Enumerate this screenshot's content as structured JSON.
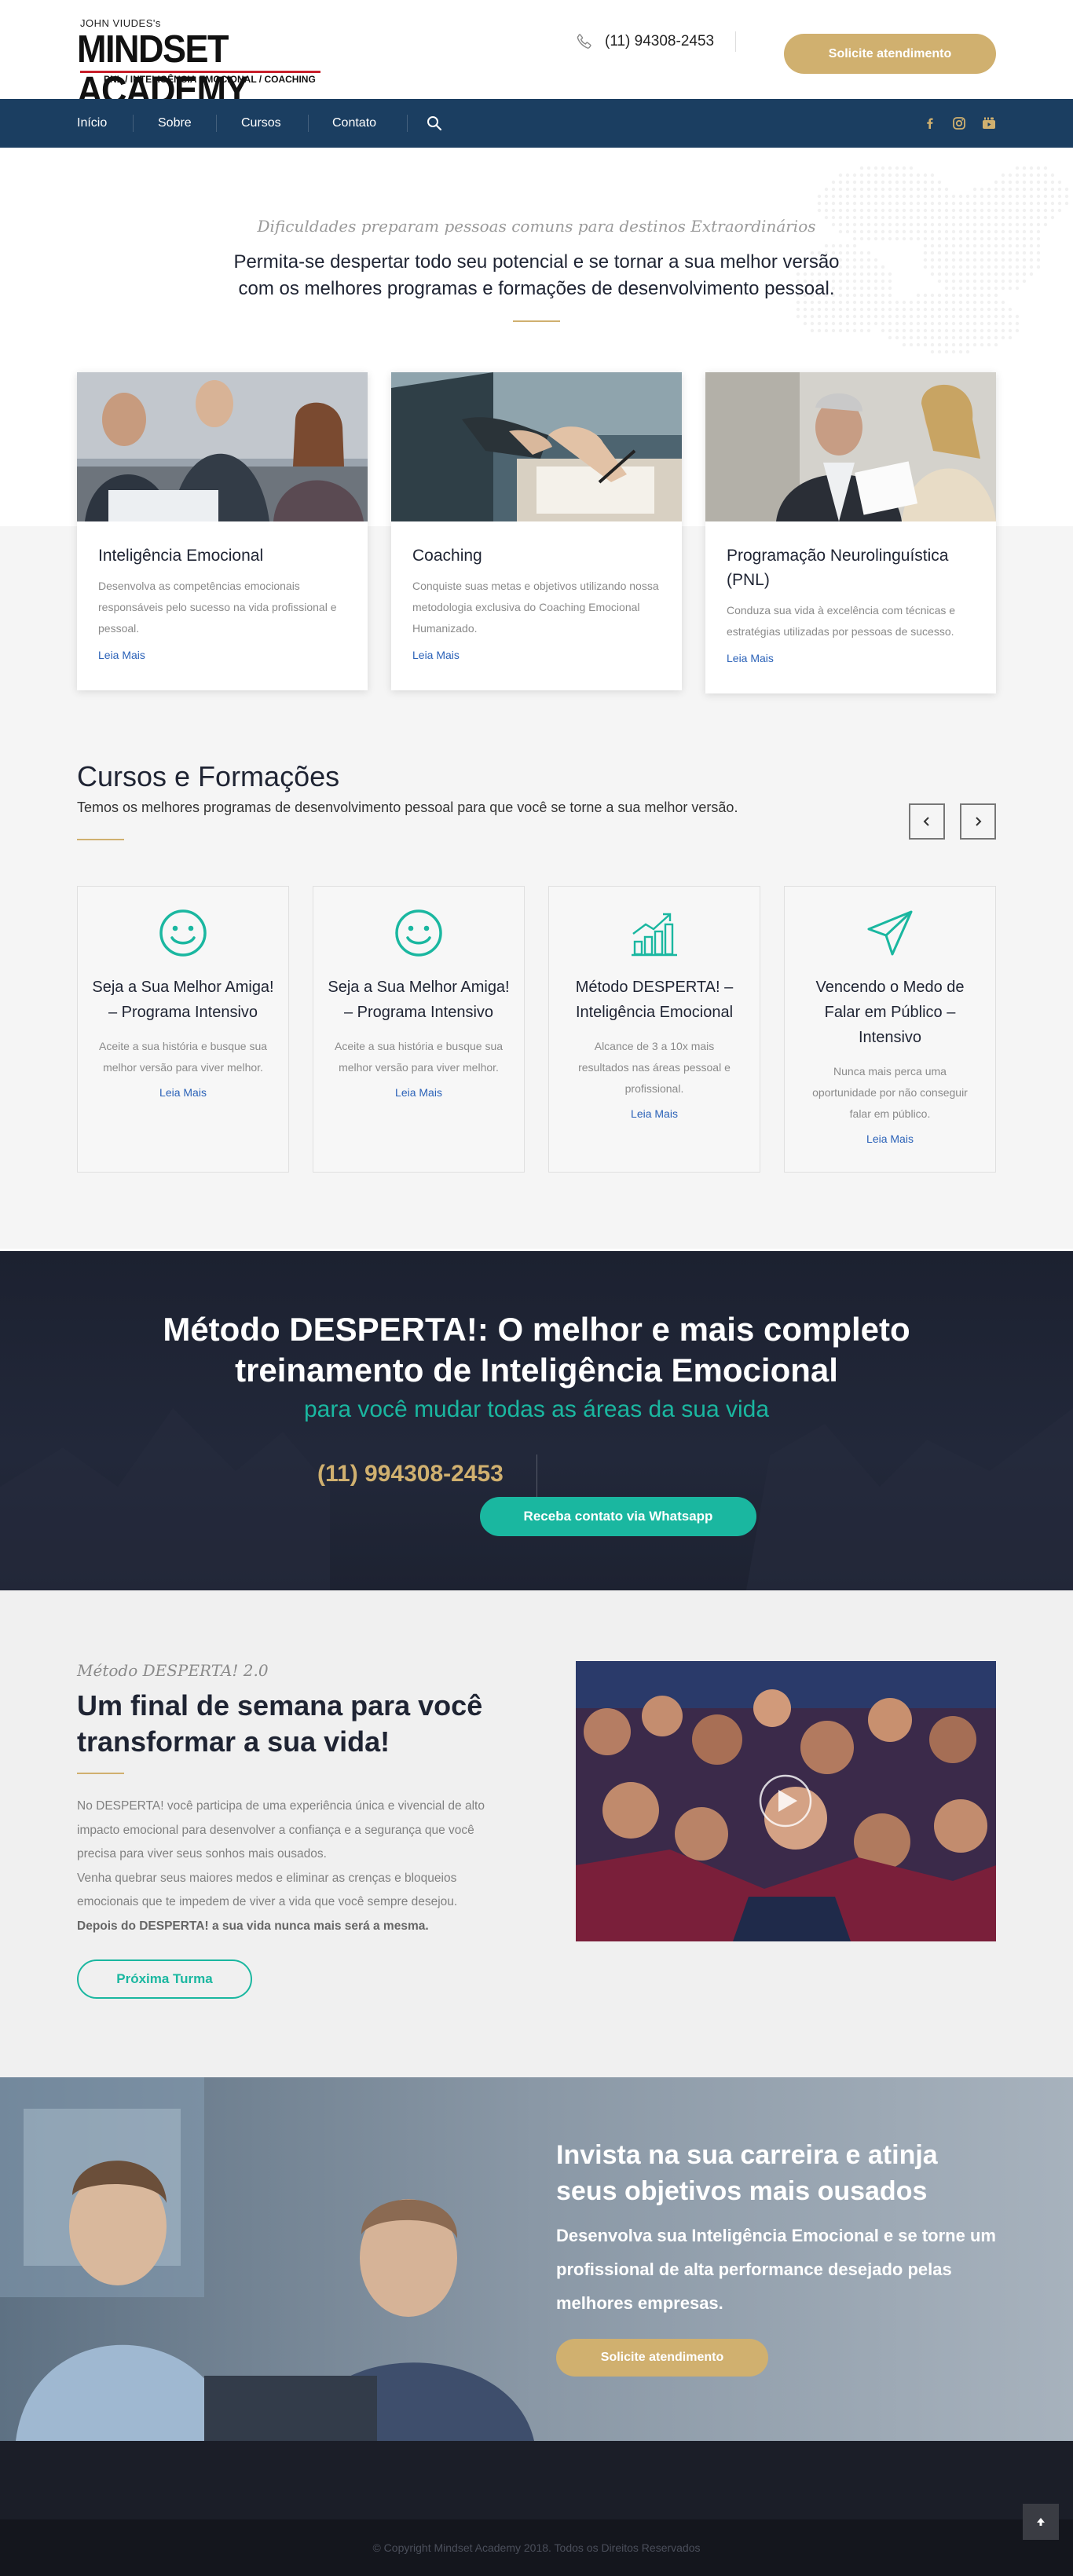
{
  "header": {
    "logo": {
      "small_text": "JOHN VIUDES's",
      "main_text": "MINDSET ACADEMY",
      "tagline": "PNL / INTELIGÊNCIA EMOCIONAL / COACHING"
    },
    "phone_icon": "phone-icon",
    "phone": "(11) 94308-2453",
    "cta_label": "Solicite atendimento",
    "cta_color": "#d0b06f"
  },
  "nav": {
    "background": "#1b3e61",
    "items": [
      {
        "label": "Início"
      },
      {
        "label": "Sobre"
      },
      {
        "label": "Cursos"
      },
      {
        "label": "Contato"
      }
    ],
    "search_icon": "search-icon",
    "social_icons": [
      "facebook-icon",
      "instagram-icon",
      "youtube-icon"
    ]
  },
  "hero": {
    "italic": "Dificuldades preparam pessoas comuns para destinos Extraordinários",
    "main_line1": "Permita-se despertar todo seu potencial e se tornar a sua melhor versão",
    "main_line2": "com os melhores programas e formações de desenvolvimento pessoal."
  },
  "features": [
    {
      "title": "Inteligência Emocional",
      "text": "Desenvolva as competências emocionais responsáveis pelo sucesso na vida profissional e pessoal.",
      "link": "Leia Mais"
    },
    {
      "title": "Coaching",
      "text": "Conquiste suas metas e objetivos utilizando nossa metodologia exclusiva do Coaching Emocional Humanizado.",
      "link": "Leia Mais"
    },
    {
      "title": "Programação Neurolinguística (PNL)",
      "text": "Conduza sua vida à excelência com técnicas e estratégias utilizadas por pessoas de sucesso.",
      "link": "Leia Mais"
    }
  ],
  "cursos": {
    "title": "Cursos e Formações",
    "subtitle": "Temos os melhores programas de desenvolvimento pessoal para que você se torne a sua melhor versão.",
    "prev_icon": "chevron-left-icon",
    "next_icon": "chevron-right-icon",
    "cards": [
      {
        "icon": "smile-icon",
        "title": "Seja a Sua Melhor Amiga! – Programa Intensivo",
        "text": "Aceite a sua história e busque sua melhor versão para viver melhor.",
        "link": "Leia Mais"
      },
      {
        "icon": "smile-icon",
        "title": "Seja a Sua Melhor Amiga! – Programa Intensivo",
        "text": "Aceite a sua história e busque sua melhor versão para viver melhor.",
        "link": "Leia Mais"
      },
      {
        "icon": "growth-chart-icon",
        "title": "Método DESPERTA! – Inteligência Emocional",
        "text": "Alcance de 3 a 10x mais resultados nas áreas pessoal e profissional.",
        "link": "Leia Mais"
      },
      {
        "icon": "paper-plane-icon",
        "title": "Vencendo o Medo de Falar em Público – Intensivo",
        "text": "Nunca mais perca uma oportunidade por não conseguir falar em público.",
        "link": "Leia Mais"
      }
    ],
    "accent": "#1ab7a0"
  },
  "banner": {
    "title_line1": "Método DESPERTA!: O melhor e mais completo",
    "title_line2": "treinamento de Inteligência Emocional",
    "subtitle": "para você mudar todas as áreas da sua vida",
    "phone": "(11) 994308-2453",
    "whatsapp_label": "Receba contato via Whatsapp"
  },
  "metodo": {
    "italic": "Método DESPERTA! 2.0",
    "title_line1": "Um final de semana para você",
    "title_line2": "transformar a sua vida!",
    "para1": "No DESPERTA! você participa de uma experiência única e vivencial de alto impacto emocional para desenvolver a confiança e a segurança que você precisa para viver seus sonhos mais ousados.",
    "para2": "Venha quebrar seus maiores medos e eliminar as crenças e bloqueios emocionais que te impedem de viver a vida que você sempre desejou.",
    "para3": "Depois do DESPERTA! a sua vida nunca mais será a mesma.",
    "button_label": "Próxima Turma",
    "play_icon": "play-icon"
  },
  "invista": {
    "title_line1": "Invista na sua carreira e atinja",
    "title_line2": "seus objetivos mais ousados",
    "body": "Desenvolva sua Inteligência Emocional e se torne um profissional de alta performance desejado pelas melhores empresas.",
    "cta_label": "Solicite atendimento"
  },
  "footer": {
    "copyright": "© Copyright Mindset Academy 2018. Todos os Direitos Reservados",
    "to_top_icon": "arrow-up-icon"
  }
}
